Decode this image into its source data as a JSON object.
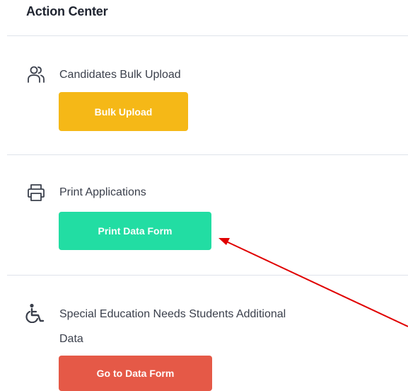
{
  "action_center": {
    "title": "Action Center",
    "items": [
      {
        "icon": "users-icon",
        "label": "Candidates Bulk Upload",
        "button_label": "Bulk Upload",
        "button_color": "#f5b817"
      },
      {
        "icon": "printer-icon",
        "label": "Print Applications",
        "button_label": "Print Data Form",
        "button_color": "#22dda3"
      },
      {
        "icon": "wheelchair-icon",
        "label_line1": "Special Education Needs Students Additional",
        "label_line2": "Data",
        "button_label": "Go to Data Form",
        "button_color": "#e55947"
      }
    ]
  },
  "annotation": {
    "arrow_color": "#e00000"
  }
}
